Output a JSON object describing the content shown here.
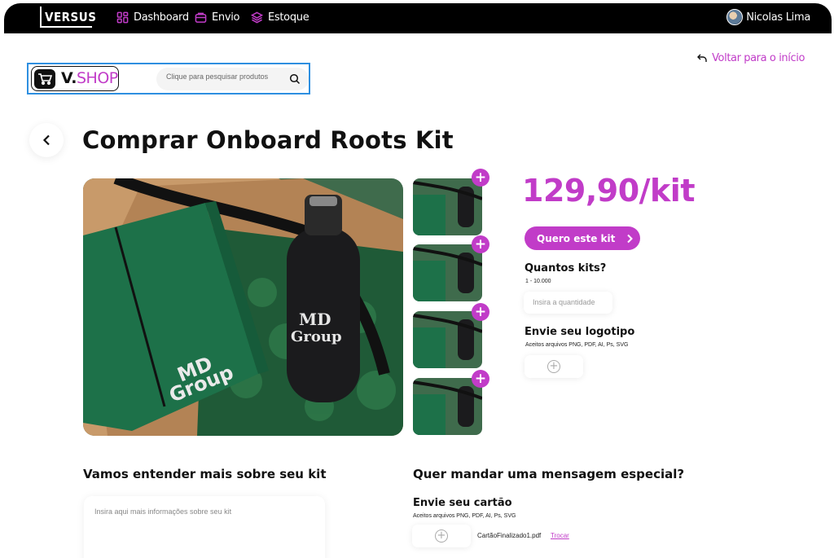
{
  "nav": {
    "brand": "VERSUS",
    "items": [
      {
        "label": "Dashboard",
        "icon": "dashboard-icon"
      },
      {
        "label": "Envio",
        "icon": "package-icon"
      },
      {
        "label": "Estoque",
        "icon": "stack-icon"
      }
    ],
    "user_name": "Nicolas Lima"
  },
  "shop": {
    "logo_v": "V.",
    "logo_shop": "SHOP",
    "search_placeholder": "Clique para pesquisar produtos"
  },
  "back_home_label": "Voltar para o início",
  "page_title": "Comprar Onboard Roots Kit",
  "product": {
    "price": "129,90/kit",
    "cta_label": "Quero este kit",
    "quantity_title": "Quantos kits?",
    "quantity_range": "1 - 10.000",
    "quantity_placeholder": "Insira a quantidade",
    "logo_title": "Envie seu logotipo",
    "logo_formats": "Aceitos arquivos PNG, PDF, AI, Ps, SVG",
    "image_brand_text": "MD Group",
    "thumbnails_count": 4
  },
  "kit_info": {
    "title": "Vamos entender mais sobre seu kit",
    "placeholder": "Insira aqui mais informações sobre seu kit"
  },
  "message": {
    "title": "Quer mandar uma mensagem especial?",
    "card_title": "Envie seu cartão",
    "card_formats": "Aceitos arquivos PNG, PDF, AI, Ps, SVG",
    "file_name": "CartãoFinalizado1.pdf",
    "replace_label": "Trocar"
  },
  "colors": {
    "accent": "#c13cc8",
    "nav_bg": "#000000",
    "focus_border": "#2e8fe0"
  }
}
